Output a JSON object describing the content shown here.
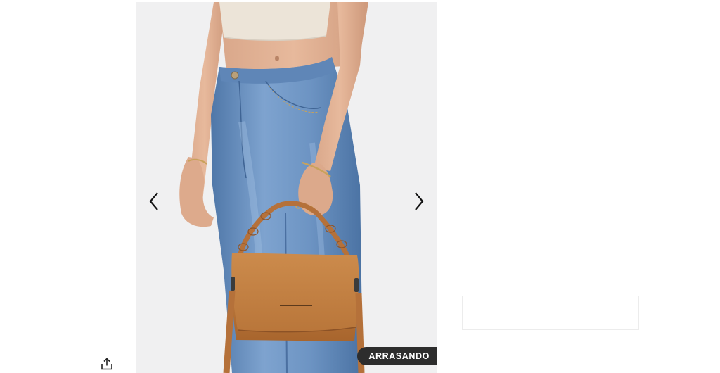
{
  "gallery": {
    "image_alt": "",
    "badge_label": "ARRASANDO",
    "prev_icon": "chevron-left-icon",
    "next_icon": "chevron-right-icon"
  },
  "actions": {
    "share_icon": "share-icon"
  },
  "colors": {
    "photo_background": "#f0f0f1",
    "badge_background": "#2d2d2d",
    "badge_text": "#ffffff",
    "denim": "#6f96c4",
    "bag_tan": "#b8743a"
  }
}
